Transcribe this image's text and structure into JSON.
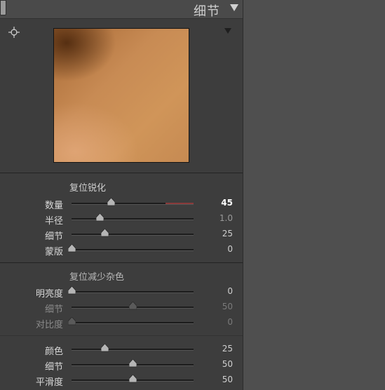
{
  "header": {
    "title": "细节"
  },
  "sharpening": {
    "title": "复位锐化",
    "rows": [
      {
        "label": "数量",
        "value": "45",
        "level": 0.32
      },
      {
        "label": "半径",
        "value": "1.0",
        "level": 0.23
      },
      {
        "label": "细节",
        "value": "25",
        "level": 0.27
      },
      {
        "label": "蒙版",
        "value": "0",
        "level": 0.0
      }
    ]
  },
  "noise_reduction": {
    "title": "复位减少杂色",
    "luminance_rows": [
      {
        "label": "明亮度",
        "value": "0",
        "level": 0.0
      },
      {
        "label": "细节",
        "value": "50",
        "level": 0.5
      },
      {
        "label": "对比度",
        "value": "0",
        "level": 0.0
      }
    ],
    "color_rows": [
      {
        "label": "颜色",
        "value": "25",
        "level": 0.27
      },
      {
        "label": "细节",
        "value": "50",
        "level": 0.5
      },
      {
        "label": "平滑度",
        "value": "50",
        "level": 0.5
      }
    ]
  },
  "colors": {
    "amount_track_highlight": "#8a3a3a",
    "panel_bg": "#3d3d3d",
    "page_bg": "#4f4f4f"
  }
}
